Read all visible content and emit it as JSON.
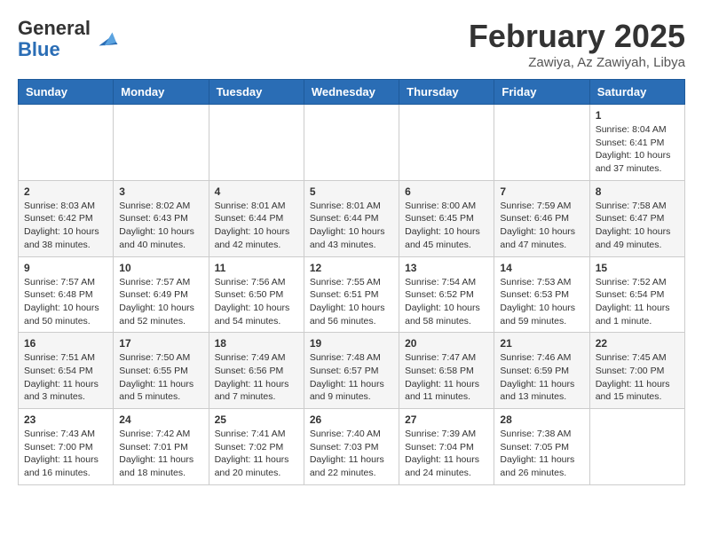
{
  "header": {
    "logo_line1": "General",
    "logo_line2": "Blue",
    "month": "February 2025",
    "location": "Zawiya, Az Zawiyah, Libya"
  },
  "weekdays": [
    "Sunday",
    "Monday",
    "Tuesday",
    "Wednesday",
    "Thursday",
    "Friday",
    "Saturday"
  ],
  "weeks": [
    [
      {
        "day": "",
        "info": ""
      },
      {
        "day": "",
        "info": ""
      },
      {
        "day": "",
        "info": ""
      },
      {
        "day": "",
        "info": ""
      },
      {
        "day": "",
        "info": ""
      },
      {
        "day": "",
        "info": ""
      },
      {
        "day": "1",
        "info": "Sunrise: 8:04 AM\nSunset: 6:41 PM\nDaylight: 10 hours and 37 minutes."
      }
    ],
    [
      {
        "day": "2",
        "info": "Sunrise: 8:03 AM\nSunset: 6:42 PM\nDaylight: 10 hours and 38 minutes."
      },
      {
        "day": "3",
        "info": "Sunrise: 8:02 AM\nSunset: 6:43 PM\nDaylight: 10 hours and 40 minutes."
      },
      {
        "day": "4",
        "info": "Sunrise: 8:01 AM\nSunset: 6:44 PM\nDaylight: 10 hours and 42 minutes."
      },
      {
        "day": "5",
        "info": "Sunrise: 8:01 AM\nSunset: 6:44 PM\nDaylight: 10 hours and 43 minutes."
      },
      {
        "day": "6",
        "info": "Sunrise: 8:00 AM\nSunset: 6:45 PM\nDaylight: 10 hours and 45 minutes."
      },
      {
        "day": "7",
        "info": "Sunrise: 7:59 AM\nSunset: 6:46 PM\nDaylight: 10 hours and 47 minutes."
      },
      {
        "day": "8",
        "info": "Sunrise: 7:58 AM\nSunset: 6:47 PM\nDaylight: 10 hours and 49 minutes."
      }
    ],
    [
      {
        "day": "9",
        "info": "Sunrise: 7:57 AM\nSunset: 6:48 PM\nDaylight: 10 hours and 50 minutes."
      },
      {
        "day": "10",
        "info": "Sunrise: 7:57 AM\nSunset: 6:49 PM\nDaylight: 10 hours and 52 minutes."
      },
      {
        "day": "11",
        "info": "Sunrise: 7:56 AM\nSunset: 6:50 PM\nDaylight: 10 hours and 54 minutes."
      },
      {
        "day": "12",
        "info": "Sunrise: 7:55 AM\nSunset: 6:51 PM\nDaylight: 10 hours and 56 minutes."
      },
      {
        "day": "13",
        "info": "Sunrise: 7:54 AM\nSunset: 6:52 PM\nDaylight: 10 hours and 58 minutes."
      },
      {
        "day": "14",
        "info": "Sunrise: 7:53 AM\nSunset: 6:53 PM\nDaylight: 10 hours and 59 minutes."
      },
      {
        "day": "15",
        "info": "Sunrise: 7:52 AM\nSunset: 6:54 PM\nDaylight: 11 hours and 1 minute."
      }
    ],
    [
      {
        "day": "16",
        "info": "Sunrise: 7:51 AM\nSunset: 6:54 PM\nDaylight: 11 hours and 3 minutes."
      },
      {
        "day": "17",
        "info": "Sunrise: 7:50 AM\nSunset: 6:55 PM\nDaylight: 11 hours and 5 minutes."
      },
      {
        "day": "18",
        "info": "Sunrise: 7:49 AM\nSunset: 6:56 PM\nDaylight: 11 hours and 7 minutes."
      },
      {
        "day": "19",
        "info": "Sunrise: 7:48 AM\nSunset: 6:57 PM\nDaylight: 11 hours and 9 minutes."
      },
      {
        "day": "20",
        "info": "Sunrise: 7:47 AM\nSunset: 6:58 PM\nDaylight: 11 hours and 11 minutes."
      },
      {
        "day": "21",
        "info": "Sunrise: 7:46 AM\nSunset: 6:59 PM\nDaylight: 11 hours and 13 minutes."
      },
      {
        "day": "22",
        "info": "Sunrise: 7:45 AM\nSunset: 7:00 PM\nDaylight: 11 hours and 15 minutes."
      }
    ],
    [
      {
        "day": "23",
        "info": "Sunrise: 7:43 AM\nSunset: 7:00 PM\nDaylight: 11 hours and 16 minutes."
      },
      {
        "day": "24",
        "info": "Sunrise: 7:42 AM\nSunset: 7:01 PM\nDaylight: 11 hours and 18 minutes."
      },
      {
        "day": "25",
        "info": "Sunrise: 7:41 AM\nSunset: 7:02 PM\nDaylight: 11 hours and 20 minutes."
      },
      {
        "day": "26",
        "info": "Sunrise: 7:40 AM\nSunset: 7:03 PM\nDaylight: 11 hours and 22 minutes."
      },
      {
        "day": "27",
        "info": "Sunrise: 7:39 AM\nSunset: 7:04 PM\nDaylight: 11 hours and 24 minutes."
      },
      {
        "day": "28",
        "info": "Sunrise: 7:38 AM\nSunset: 7:05 PM\nDaylight: 11 hours and 26 minutes."
      },
      {
        "day": "",
        "info": ""
      }
    ]
  ]
}
